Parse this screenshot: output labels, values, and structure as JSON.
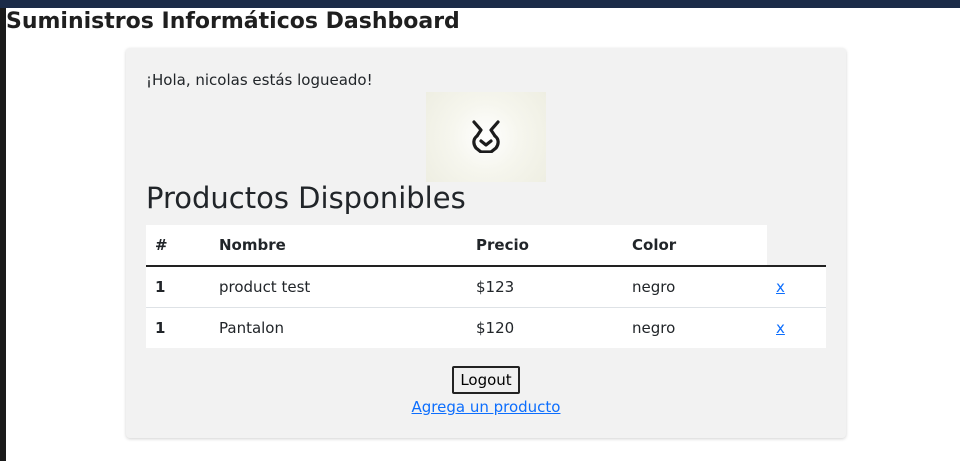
{
  "app": {
    "title": "Suministros Informáticos Dashboard"
  },
  "card": {
    "greeting": "¡Hola, nicolas estás logueado!",
    "logo_icon": "winged-logo-icon",
    "section_title": "Productos Disponibles",
    "table": {
      "headers": [
        "#",
        "Nombre",
        "Precio",
        "Color",
        ""
      ],
      "rows": [
        {
          "index": "1",
          "name": "product test",
          "price": "$123",
          "color": "negro",
          "delete": "x"
        },
        {
          "index": "1",
          "name": "Pantalon",
          "price": "$120",
          "color": "negro",
          "delete": "x"
        }
      ]
    },
    "logout_label": "Logout",
    "add_link": "Agrega un producto"
  },
  "colors": {
    "topbar": "#1b2b48",
    "link": "#0d6efd",
    "card_bg": "#f2f2f2"
  }
}
